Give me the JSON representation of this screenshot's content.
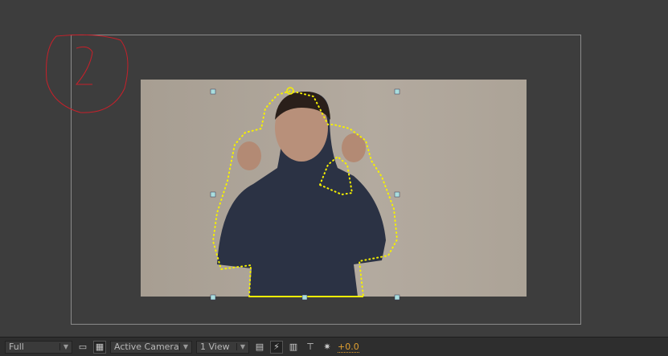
{
  "toolbar": {
    "resolution": "Full",
    "camera": "Active Camera",
    "views": "1 View",
    "exposure": "+0.0"
  },
  "colors": {
    "mask": "#f5f000",
    "annotation": "#c8202a",
    "background": "#3d3d3d"
  }
}
